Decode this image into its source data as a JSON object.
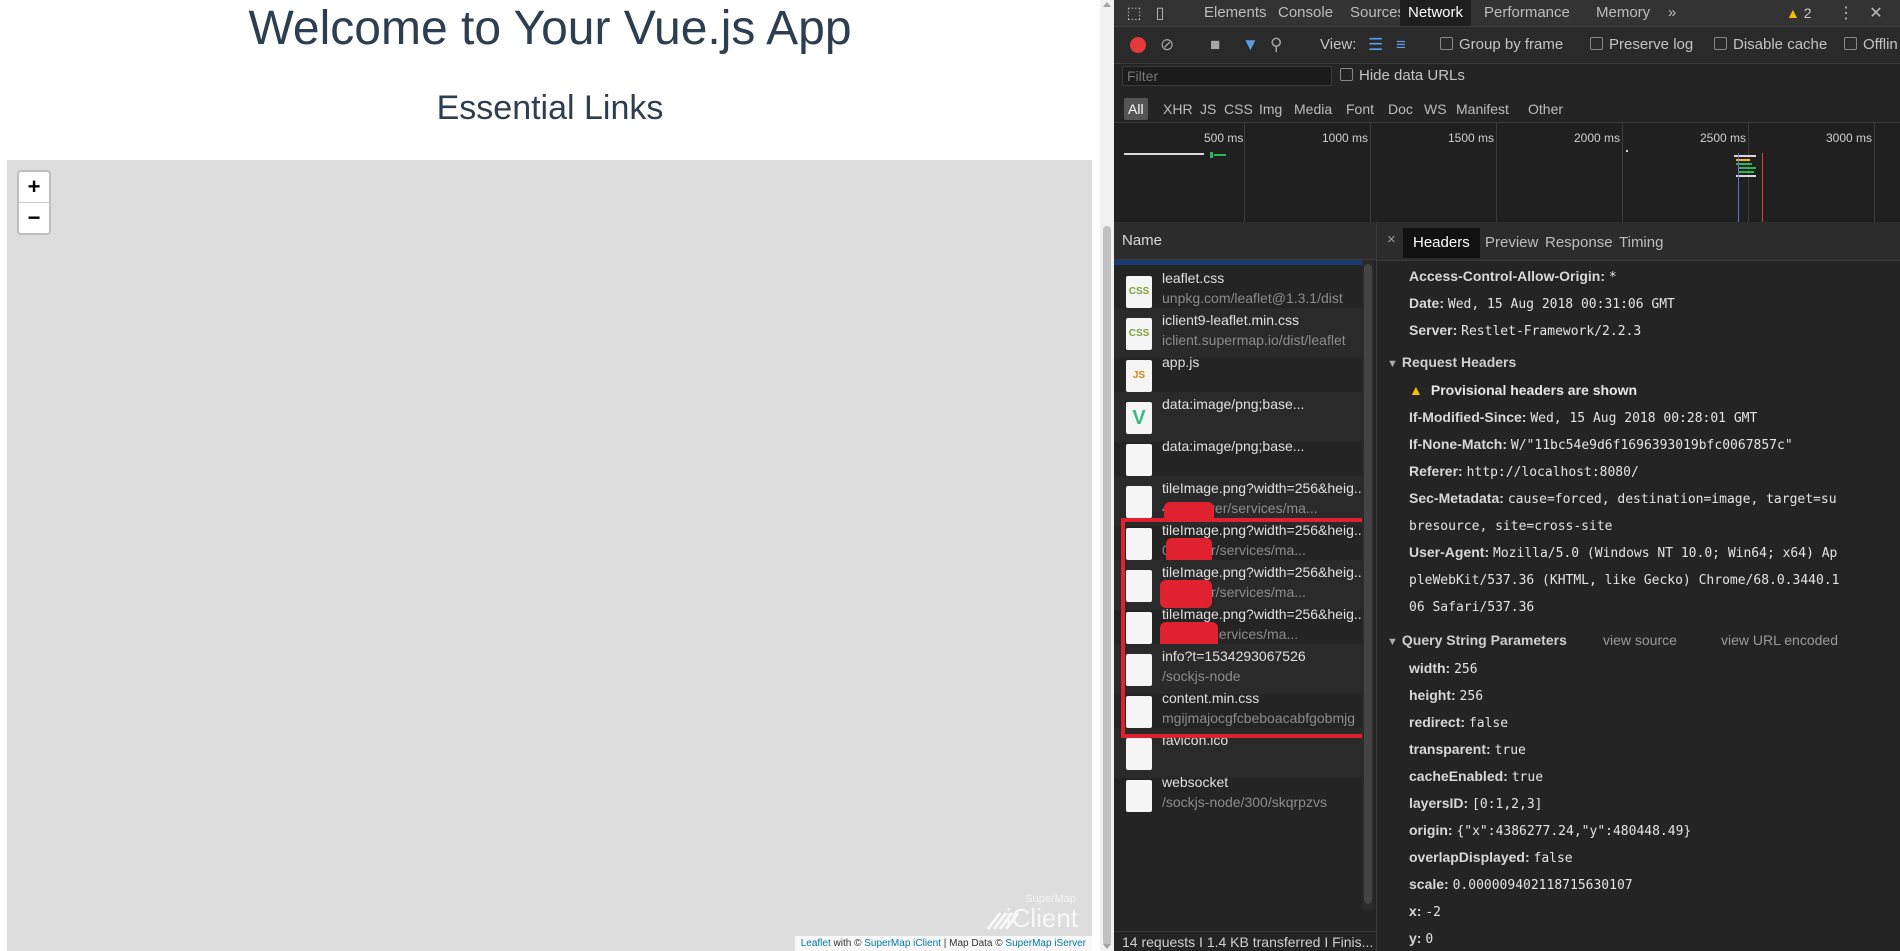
{
  "app": {
    "title": "Welcome to Your Vue.js App",
    "subtitle": "Essential Links",
    "zoom_in": "+",
    "zoom_out": "−",
    "brand_small": "SuperMap",
    "brand_big": "iClient",
    "attribution": {
      "leaflet": "Leaflet",
      "with": " with © ",
      "iclient": "SuperMap iClient",
      "mapdata": " | Map Data © ",
      "iserver": "SuperMap iServer"
    }
  },
  "devtools": {
    "tabs": [
      "Elements",
      "Console",
      "Sources",
      "Network",
      "Performance",
      "Memory"
    ],
    "active_tab": "Network",
    "more": "»",
    "warnings": "2",
    "toolbar": {
      "view_label": "View:",
      "group_by_frame": "Group by frame",
      "preserve_log": "Preserve log",
      "disable_cache": "Disable cache",
      "offline": "Offlin"
    },
    "filter_placeholder": "Filter",
    "hide_data_urls": "Hide data URLs",
    "types": [
      "All",
      "XHR",
      "JS",
      "CSS",
      "Img",
      "Media",
      "Font",
      "Doc",
      "WS",
      "Manifest",
      "Other"
    ],
    "timeline_ticks": [
      "500 ms",
      "1000 ms",
      "1500 ms",
      "2000 ms",
      "2500 ms",
      "3000 ms"
    ],
    "name_header": "Name",
    "requests": [
      {
        "name": "leaflet.css",
        "sub": "unpkg.com/leaflet@1.3.1/dist",
        "type": "CSS"
      },
      {
        "name": "iclient9-leaflet.min.css",
        "sub": "iclient.supermap.io/dist/leaflet",
        "type": "CSS"
      },
      {
        "name": "app.js",
        "sub": "",
        "type": "JS"
      },
      {
        "name": "data:image/png;base...",
        "sub": "",
        "type": "V"
      },
      {
        "name": "data:image/png;base...",
        "sub": "",
        "type": ""
      },
      {
        "name": "tileImage.png?width=256&heig...",
        "sub": "4      0/iserver/services/ma...",
        "type": ""
      },
      {
        "name": "tileImage.png?width=256&heig...",
        "sub": "       0/iserver/services/ma...",
        "type": ""
      },
      {
        "name": "tileImage.png?width=256&heig...",
        "sub": "       0/iserver/services/ma...",
        "type": ""
      },
      {
        "name": "tileImage.png?width=256&heig...",
        "sub": "        /iserver/services/ma...",
        "type": ""
      },
      {
        "name": "info?t=1534293067526",
        "sub": "/sockjs-node",
        "type": ""
      },
      {
        "name": "content.min.css",
        "sub": "mgijmajocgfcbeboacabfgobmjg",
        "type": ""
      },
      {
        "name": "favicon.ico",
        "sub": "",
        "type": ""
      },
      {
        "name": "websocket",
        "sub": "/sockjs-node/300/skqrpzvs",
        "type": ""
      }
    ],
    "status": "14 requests  I  1.4 KB transferred  I  Finis...",
    "detail_tabs": [
      "Headers",
      "Preview",
      "Response",
      "Timing"
    ],
    "detail_close": "×",
    "response_headers": [
      {
        "k": "Access-Control-Allow-Origin:",
        "v": "*"
      },
      {
        "k": "Date:",
        "v": "Wed, 15 Aug 2018 00:31:06 GMT"
      },
      {
        "k": "Server:",
        "v": "Restlet-Framework/2.2.3"
      }
    ],
    "request_headers_title": "Request Headers",
    "provisional": "Provisional headers are shown",
    "request_headers": [
      {
        "k": "If-Modified-Since:",
        "v": "Wed, 15 Aug 2018 00:28:01 GMT"
      },
      {
        "k": "If-None-Match:",
        "v": "W/\"11bc54e9d6f1696393019bfc0067857c\""
      },
      {
        "k": "Referer:",
        "v": "http://localhost:8080/"
      },
      {
        "k": "Sec-Metadata:",
        "v": "cause=forced, destination=image, target=su"
      },
      {
        "k": "",
        "v": "bresource, site=cross-site"
      },
      {
        "k": "User-Agent:",
        "v": "Mozilla/5.0 (Windows NT 10.0; Win64; x64) Ap"
      },
      {
        "k": "",
        "v": "pleWebKit/537.36 (KHTML, like Gecko) Chrome/68.0.3440.1"
      },
      {
        "k": "",
        "v": "06 Safari/537.36"
      }
    ],
    "query_title": "Query String Parameters",
    "view_source": "view source",
    "view_url_encoded": "view URL encoded",
    "query_params": [
      {
        "k": "width:",
        "v": "256"
      },
      {
        "k": "height:",
        "v": "256"
      },
      {
        "k": "redirect:",
        "v": "false"
      },
      {
        "k": "transparent:",
        "v": "true"
      },
      {
        "k": "cacheEnabled:",
        "v": "true"
      },
      {
        "k": "layersID:",
        "v": "[0:1,2,3]"
      },
      {
        "k": "origin:",
        "v": "{\"x\":4386277.24,\"y\":480448.49}"
      },
      {
        "k": "overlapDisplayed:",
        "v": "false"
      },
      {
        "k": "scale:",
        "v": "0.000009402118715630107"
      },
      {
        "k": "x:",
        "v": "-2"
      },
      {
        "k": "y:",
        "v": "0"
      }
    ]
  }
}
